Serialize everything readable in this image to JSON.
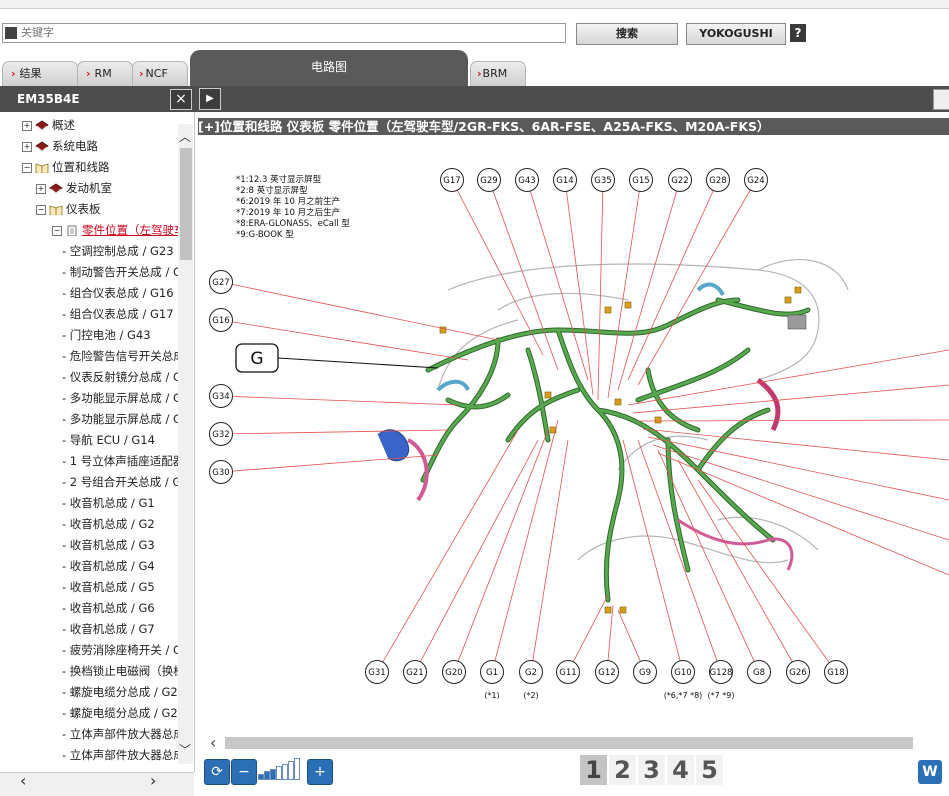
{
  "search": {
    "placeholder": "关键字",
    "search_label": "搜索",
    "yokogushi_label": "YOKOGUSHI",
    "help_label": "?"
  },
  "tabs": [
    {
      "label": "结果"
    },
    {
      "label": "RM"
    },
    {
      "label": "NCF"
    },
    {
      "label": "电路图"
    },
    {
      "label": "BRM"
    }
  ],
  "header": {
    "doc_code": "EM35B4E",
    "close_label": "×",
    "play_label": "▶"
  },
  "sidebar": {
    "items": [
      {
        "label": "概述",
        "expander": "+",
        "icon": "book-closed-icon"
      },
      {
        "label": "系统电路",
        "expander": "+",
        "icon": "book-closed-icon"
      },
      {
        "label": "位置和线路",
        "expander": "−",
        "icon": "book-open-icon"
      },
      {
        "label": "发动机室",
        "expander": "+",
        "icon": "book-closed-icon"
      },
      {
        "label": "仪表板",
        "expander": "−",
        "icon": "book-open-icon"
      },
      {
        "label": "零件位置（左驾驶车",
        "expander": "−",
        "icon": "document-icon"
      },
      {
        "label": "- 空调控制总成 / G23"
      },
      {
        "label": "- 制动警告开关总成 / G"
      },
      {
        "label": "- 组合仪表总成 / G16"
      },
      {
        "label": "- 组合仪表总成 / G17"
      },
      {
        "label": "- 门控电池 / G43"
      },
      {
        "label": "- 危险警告信号开关总成"
      },
      {
        "label": "- 仪表反射镜分总成 / G"
      },
      {
        "label": "- 多功能显示屏总成 / G"
      },
      {
        "label": "- 多功能显示屏总成 / G"
      },
      {
        "label": "- 导航 ECU / G14"
      },
      {
        "label": "- 1 号立体声插座适配器"
      },
      {
        "label": "- 2 号组合开关总成 / G"
      },
      {
        "label": "- 收音机总成 / G1"
      },
      {
        "label": "- 收音机总成 / G2"
      },
      {
        "label": "- 收音机总成 / G3"
      },
      {
        "label": "- 收音机总成 / G4"
      },
      {
        "label": "- 收音机总成 / G5"
      },
      {
        "label": "- 收音机总成 / G6"
      },
      {
        "label": "- 收音机总成 / G7"
      },
      {
        "label": "- 疲劳消除座椅开关 / G"
      },
      {
        "label": "- 换档锁止电磁阀（换档"
      },
      {
        "label": "- 螺旋电缆分总成 / G2"
      },
      {
        "label": "- 螺旋电缆分总成 / G2"
      },
      {
        "label": "- 立体声部件放大器总成"
      },
      {
        "label": "- 立体声部件放大器总成"
      }
    ]
  },
  "diagram": {
    "title": "[+]位置和线路  仪表板  零件位置（左驾驶车型/2GR-FKS、6AR-FSE、A25A-FKS、M20A-FKS）",
    "notes": [
      "*1:12.3 英寸显示屏型",
      "*2:8 英寸显示屏型",
      "*6:2019 年 10 月之前生产",
      "*7:2019 年 10 月之后生产",
      "*8:ERA-GLONASS、eCall 型",
      "*9:G-BOOK 型"
    ],
    "top_connectors": [
      "G17",
      "G29",
      "G43",
      "G14",
      "G35",
      "G15",
      "G22",
      "G28",
      "G24"
    ],
    "left_connectors": [
      "G27",
      "G16",
      "G34",
      "G32",
      "G30"
    ],
    "bottom_connectors": [
      "G31",
      "G21",
      "G20",
      "G1",
      "G2",
      "G11",
      "G12",
      "G9",
      "G10",
      "G128",
      "G8",
      "G26",
      "G18"
    ],
    "bottom_notes": {
      "G1": "(*1)",
      "G2": "(*2)",
      "G10": "(*6,*7 *8)",
      "G128": "(*7 *9)"
    },
    "callout_label": "G"
  },
  "pages": [
    "1",
    "2",
    "3",
    "4",
    "5"
  ],
  "current_page": "1",
  "toolbar": {
    "w_label": "W",
    "zoom_level_bars": 7,
    "zoom_level_filled": 3
  },
  "colors": {
    "accent_red": "#d0021b",
    "harness_green": "#3f8a3a",
    "dark_header": "#4d4d4d",
    "tool_blue": "#2b6fb5"
  }
}
